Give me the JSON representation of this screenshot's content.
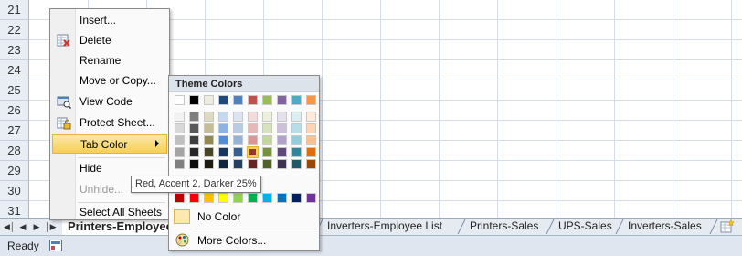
{
  "rows": [
    "21",
    "22",
    "23",
    "24",
    "25",
    "26",
    "27",
    "28",
    "29",
    "30",
    "31"
  ],
  "sheet_tabs": [
    {
      "label": "Printers-Employee"
    },
    {
      "label": "Inverters-Employee List"
    },
    {
      "label": "Printers-Sales"
    },
    {
      "label": "UPS-Sales"
    },
    {
      "label": "Inverters-Sales"
    }
  ],
  "status": {
    "text": "Ready"
  },
  "context_menu": {
    "items": [
      {
        "label": "Insert...",
        "icon": "none"
      },
      {
        "label": "Delete",
        "icon": "delete-sheet-icon"
      },
      {
        "label": "Rename",
        "icon": "none"
      },
      {
        "label": "Move or Copy...",
        "icon": "none"
      },
      {
        "label": "View Code",
        "icon": "view-code-icon"
      },
      {
        "label": "Protect Sheet...",
        "icon": "protect-sheet-icon"
      },
      {
        "label": "Tab Color",
        "icon": "none",
        "submenu": true,
        "highlighted": true
      },
      {
        "label": "Hide",
        "icon": "none"
      },
      {
        "label": "Unhide...",
        "icon": "none",
        "disabled": true
      },
      {
        "label": "Select All Sheets",
        "icon": "none"
      }
    ]
  },
  "tab_color_panel": {
    "theme_title": "Theme Colors",
    "theme_colors": [
      [
        "#ffffff",
        "#000000",
        "#eeece1",
        "#1f497d",
        "#4f81bd",
        "#c0504d",
        "#9bbb59",
        "#8064a2",
        "#4bacc6",
        "#f79646"
      ],
      [
        "#f2f2f2",
        "#7f7f7f",
        "#ddd9c3",
        "#c6d9f0",
        "#dbe5f1",
        "#f2dcdb",
        "#ebf1dd",
        "#e5e0ec",
        "#dbeef3",
        "#fdeada"
      ],
      [
        "#d8d8d8",
        "#595959",
        "#c4bd97",
        "#8db3e2",
        "#b8cce4",
        "#e5b9b7",
        "#d7e3bc",
        "#ccc1d9",
        "#b7dde8",
        "#fbd5b5"
      ],
      [
        "#bfbfbf",
        "#3f3f3f",
        "#938953",
        "#548dd4",
        "#95b3d7",
        "#d99694",
        "#c3d69b",
        "#b2a2c7",
        "#92cddc",
        "#fac08f"
      ],
      [
        "#a5a5a5",
        "#262626",
        "#494429",
        "#17365d",
        "#366092",
        "#953734",
        "#76923c",
        "#5f497a",
        "#31859b",
        "#e36c09"
      ],
      [
        "#7f7f7f",
        "#0c0c0c",
        "#1d1b10",
        "#0f243e",
        "#244061",
        "#632423",
        "#4f6128",
        "#3f3151",
        "#205867",
        "#974806"
      ]
    ],
    "selected_swatch": "Red, Accent 2, Darker 25%",
    "standard_colors": [
      "#c00000",
      "#ff0000",
      "#ffc000",
      "#ffff00",
      "#92d050",
      "#00b050",
      "#00b0f0",
      "#0070c0",
      "#002060",
      "#7030a0"
    ],
    "no_color_label": "No Color",
    "more_colors_label": "More Colors..."
  },
  "tooltip": {
    "text": "Red, Accent 2, Darker 25%"
  }
}
